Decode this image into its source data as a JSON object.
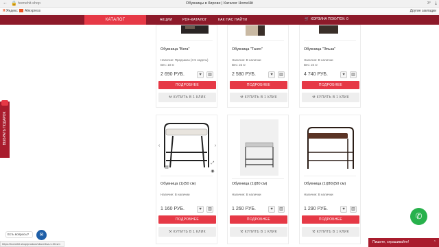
{
  "browser": {
    "url": "homehit.shop",
    "title": "Обувницы в Кирове | Каталог HomeHit",
    "weather": "3°",
    "bookmarks": [
      "Яндекс",
      "Aliexpress",
      "Другие закладки"
    ]
  },
  "nav": {
    "catalog": "КАТАЛОГ",
    "links": [
      "АКЦИИ",
      "PDF-КАТАЛОГ",
      "КАК НАС НАЙТИ"
    ],
    "cart": "КОРЗИНА ПОКУПОК: 0"
  },
  "colors": {
    "nav_bg": "#8d1a2a",
    "accent": "#e63946",
    "whatsapp": "#28b14c",
    "chat": "#1e5fa8"
  },
  "products": [
    {
      "name": "Обувница \"Вега\"",
      "availability": "Наличие: Предзаказ (3-5 недель)",
      "weight": "Вес: 10 кг",
      "price": "2 690 РУБ."
    },
    {
      "name": "Обувница \"Танго\"",
      "availability": "Наличие: В наличии",
      "weight": "Вес: 22 кг",
      "price": "2 580 РУБ."
    },
    {
      "name": "Обувница \"Эльза\"",
      "availability": "Наличие: В наличии",
      "weight": "Вес: 24 кг",
      "price": "4 740 РУБ."
    },
    {
      "name": "Обувница (1)(50 см)",
      "availability": "Наличие: В наличии",
      "weight": "",
      "price": "1 160 РУБ."
    },
    {
      "name": "Обувница (1)(80 см)",
      "availability": "Наличие: В наличии",
      "weight": "",
      "price": "1 260 РУБ."
    },
    {
      "name": "Обувница (1)(80)(50 см)",
      "availability": "Наличие: В наличии",
      "weight": "",
      "price": "1 290 РУБ."
    }
  ],
  "buttons": {
    "details": "ПОДРОБНЕЕ",
    "one_click": "КУПИТЬ В 1 КЛИК"
  },
  "side_tab": "ВЫБРАТЬ ПОДАРОК",
  "chat": {
    "bubble": "Есть вопросы?"
  },
  "status_url": "https://homehit.shop/product/obuvnitsa-1-50-sm",
  "write_bar": "Пишите, спрашивайте!"
}
